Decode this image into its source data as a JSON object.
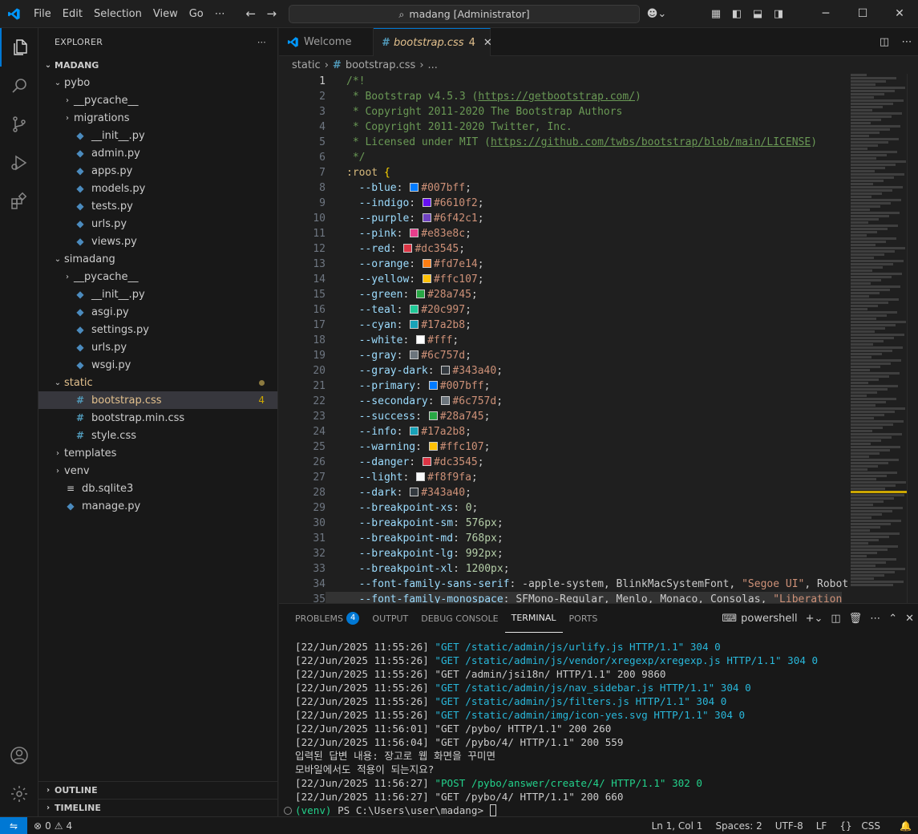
{
  "menu": [
    "File",
    "Edit",
    "Selection",
    "View",
    "Go",
    "⋯"
  ],
  "search": {
    "text": "madang [Administrator]"
  },
  "explorer": {
    "title": "EXPLORER",
    "root": "MADANG",
    "tree": [
      {
        "label": "pybo",
        "type": "folder-open",
        "depth": 1
      },
      {
        "label": "__pycache__",
        "type": "folder",
        "depth": 2
      },
      {
        "label": "migrations",
        "type": "folder",
        "depth": 2
      },
      {
        "label": "__init__.py",
        "type": "py",
        "depth": 2
      },
      {
        "label": "admin.py",
        "type": "py",
        "depth": 2
      },
      {
        "label": "apps.py",
        "type": "py",
        "depth": 2
      },
      {
        "label": "models.py",
        "type": "py",
        "depth": 2
      },
      {
        "label": "tests.py",
        "type": "py",
        "depth": 2
      },
      {
        "label": "urls.py",
        "type": "py",
        "depth": 2
      },
      {
        "label": "views.py",
        "type": "py",
        "depth": 2
      },
      {
        "label": "simadang",
        "type": "folder-open",
        "depth": 1
      },
      {
        "label": "__pycache__",
        "type": "folder",
        "depth": 2
      },
      {
        "label": "__init__.py",
        "type": "py",
        "depth": 2
      },
      {
        "label": "asgi.py",
        "type": "py",
        "depth": 2
      },
      {
        "label": "settings.py",
        "type": "py",
        "depth": 2
      },
      {
        "label": "urls.py",
        "type": "py",
        "depth": 2
      },
      {
        "label": "wsgi.py",
        "type": "py",
        "depth": 2
      },
      {
        "label": "static",
        "type": "folder-open",
        "depth": 1,
        "modified": true
      },
      {
        "label": "bootstrap.css",
        "type": "css",
        "depth": 2,
        "selected": true,
        "count": "4"
      },
      {
        "label": "bootstrap.min.css",
        "type": "css",
        "depth": 2
      },
      {
        "label": "style.css",
        "type": "css",
        "depth": 2
      },
      {
        "label": "templates",
        "type": "folder",
        "depth": 1
      },
      {
        "label": "venv",
        "type": "folder",
        "depth": 1
      },
      {
        "label": "db.sqlite3",
        "type": "db",
        "depth": 1
      },
      {
        "label": "manage.py",
        "type": "py",
        "depth": 1
      }
    ],
    "outline": "OUTLINE",
    "timeline": "TIMELINE"
  },
  "tabs": [
    {
      "label": "Welcome",
      "active": false
    },
    {
      "label": "bootstrap.css",
      "active": true,
      "count": "4"
    }
  ],
  "breadcrumbs": [
    "static",
    "bootstrap.css",
    "..."
  ],
  "code_lines": [
    {
      "n": 1,
      "t": [
        [
          "cm",
          "/*!"
        ]
      ]
    },
    {
      "n": 2,
      "t": [
        [
          "cm",
          " * Bootstrap v4.5.3 ("
        ],
        [
          "link",
          "https://getbootstrap.com/"
        ],
        [
          "cm",
          ")"
        ]
      ]
    },
    {
      "n": 3,
      "t": [
        [
          "cm",
          " * Copyright 2011-2020 The Bootstrap Authors"
        ]
      ]
    },
    {
      "n": 4,
      "t": [
        [
          "cm",
          " * Copyright 2011-2020 Twitter, Inc."
        ]
      ]
    },
    {
      "n": 5,
      "t": [
        [
          "cm",
          " * Licensed under MIT ("
        ],
        [
          "link",
          "https://github.com/twbs/bootstrap/blob/main/LICENSE"
        ],
        [
          "cm",
          ")"
        ]
      ]
    },
    {
      "n": 6,
      "t": [
        [
          "cm",
          " */"
        ]
      ]
    },
    {
      "n": 7,
      "t": [
        [
          "sel",
          ":root "
        ],
        [
          "brace",
          "{"
        ]
      ]
    },
    {
      "n": 8,
      "prop": "--blue",
      "color": "#007bff"
    },
    {
      "n": 9,
      "prop": "--indigo",
      "color": "#6610f2"
    },
    {
      "n": 10,
      "prop": "--purple",
      "color": "#6f42c1"
    },
    {
      "n": 11,
      "prop": "--pink",
      "color": "#e83e8c"
    },
    {
      "n": 12,
      "prop": "--red",
      "color": "#dc3545"
    },
    {
      "n": 13,
      "prop": "--orange",
      "color": "#fd7e14"
    },
    {
      "n": 14,
      "prop": "--yellow",
      "color": "#ffc107"
    },
    {
      "n": 15,
      "prop": "--green",
      "color": "#28a745"
    },
    {
      "n": 16,
      "prop": "--teal",
      "color": "#20c997"
    },
    {
      "n": 17,
      "prop": "--cyan",
      "color": "#17a2b8"
    },
    {
      "n": 18,
      "prop": "--white",
      "color": "#fff"
    },
    {
      "n": 19,
      "prop": "--gray",
      "color": "#6c757d"
    },
    {
      "n": 20,
      "prop": "--gray-dark",
      "color": "#343a40"
    },
    {
      "n": 21,
      "prop": "--primary",
      "color": "#007bff"
    },
    {
      "n": 22,
      "prop": "--secondary",
      "color": "#6c757d"
    },
    {
      "n": 23,
      "prop": "--success",
      "color": "#28a745"
    },
    {
      "n": 24,
      "prop": "--info",
      "color": "#17a2b8"
    },
    {
      "n": 25,
      "prop": "--warning",
      "color": "#ffc107"
    },
    {
      "n": 26,
      "prop": "--danger",
      "color": "#dc3545"
    },
    {
      "n": 27,
      "prop": "--light",
      "color": "#f8f9fa"
    },
    {
      "n": 28,
      "prop": "--dark",
      "color": "#343a40"
    },
    {
      "n": 29,
      "prop": "--breakpoint-xs",
      "num": "0"
    },
    {
      "n": 30,
      "prop": "--breakpoint-sm",
      "num": "576px"
    },
    {
      "n": 31,
      "prop": "--breakpoint-md",
      "num": "768px"
    },
    {
      "n": 32,
      "prop": "--breakpoint-lg",
      "num": "992px"
    },
    {
      "n": 33,
      "prop": "--breakpoint-xl",
      "num": "1200px"
    },
    {
      "n": 34,
      "prop": "--font-family-sans-serif",
      "raw": "-apple-system, BlinkMacSystemFont, ",
      "str": "\"Segoe UI\"",
      "tail": ", Robot"
    },
    {
      "n": 35,
      "prop": "--font-family-monospace",
      "raw": "SFMono-Regular, Menlo, Monaco, Consolas, ",
      "str": "\"Liberation"
    }
  ],
  "panel": {
    "tabs": [
      {
        "label": "PROBLEMS",
        "badge": "4"
      },
      {
        "label": "OUTPUT"
      },
      {
        "label": "DEBUG CONSOLE"
      },
      {
        "label": "TERMINAL",
        "active": true
      },
      {
        "label": "PORTS"
      }
    ],
    "shell": "powershell",
    "terminal": [
      {
        "ts": "[22/Jun/2025 11:55:26] ",
        "req": "\"GET /static/admin/js/urlify.js HTTP/1.1\" 304 0",
        "kind": "static"
      },
      {
        "ts": "[22/Jun/2025 11:55:26] ",
        "req": "\"GET /static/admin/js/vendor/xregexp/xregexp.js HTTP/1.1\" 304 0",
        "kind": "static"
      },
      {
        "ts": "[22/Jun/2025 11:55:26] ",
        "req": "\"GET /admin/jsi18n/ HTTP/1.1\" 200 9860",
        "kind": "plain"
      },
      {
        "ts": "[22/Jun/2025 11:55:26] ",
        "req": "\"GET /static/admin/js/nav_sidebar.js HTTP/1.1\" 304 0",
        "kind": "static"
      },
      {
        "ts": "[22/Jun/2025 11:55:26] ",
        "req": "\"GET /static/admin/js/filters.js HTTP/1.1\" 304 0",
        "kind": "static"
      },
      {
        "ts": "[22/Jun/2025 11:55:26] ",
        "req": "\"GET /static/admin/img/icon-yes.svg HTTP/1.1\" 304 0",
        "kind": "static"
      },
      {
        "ts": "[22/Jun/2025 11:56:01] ",
        "req": "\"GET /pybo/ HTTP/1.1\" 200 260",
        "kind": "plain"
      },
      {
        "ts": "[22/Jun/2025 11:56:04] ",
        "req": "\"GET /pybo/4/ HTTP/1.1\" 200 559",
        "kind": "plain"
      },
      {
        "ts": "",
        "req": "입력된 답변 내용: 장고로 웹 화면을 꾸미면",
        "kind": "plain"
      },
      {
        "ts": "",
        "req": "모바일에서도 적용이 되는지요?",
        "kind": "plain"
      },
      {
        "ts": "[22/Jun/2025 11:56:27] ",
        "req": "\"POST /pybo/answer/create/4/ HTTP/1.1\" 302 0",
        "kind": "post"
      },
      {
        "ts": "[22/Jun/2025 11:56:27] ",
        "req": "\"GET /pybo/4/ HTTP/1.1\" 200 660",
        "kind": "plain"
      }
    ],
    "prompt_venv": "(venv)",
    "prompt": " PS C:\\Users\\user\\madang> "
  },
  "status": {
    "errors": "0",
    "warnings": "4",
    "position": "Ln 1, Col 1",
    "spaces": "Spaces: 2",
    "encoding": "UTF-8",
    "eol": "LF",
    "language": "CSS"
  }
}
